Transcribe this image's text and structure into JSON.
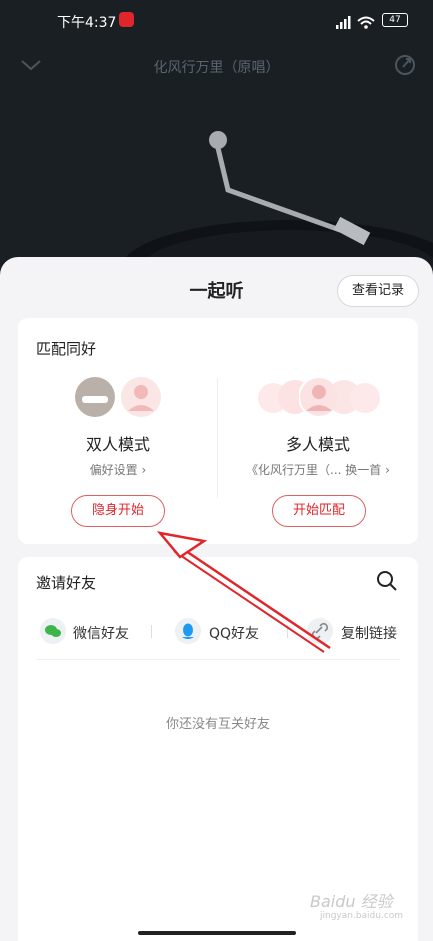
{
  "status": {
    "time": "下午4:37",
    "battery": "47"
  },
  "player": {
    "title": "化风行万里（原唱）"
  },
  "sheet": {
    "title": "一起听",
    "history_button": "查看记录",
    "match_section": "匹配同好",
    "modes": [
      {
        "title": "双人模式",
        "subtitle": "偏好设置",
        "button": "隐身开始"
      },
      {
        "title": "多人模式",
        "subtitle": "《化风行万里（... 换一首",
        "button": "开始匹配"
      }
    ],
    "invite_section": "邀请好友",
    "share": [
      {
        "label": "微信好友",
        "icon": "wechat-icon"
      },
      {
        "label": "QQ好友",
        "icon": "qq-icon"
      },
      {
        "label": "复制链接",
        "icon": "link-icon"
      }
    ],
    "empty_text": "你还没有互关好友"
  },
  "watermark": {
    "main": "Baidu 经验",
    "sub": "jingyan.baidu.com"
  },
  "colors": {
    "accent": "#e0262b",
    "sheet_bg": "#f4f4f7",
    "dark_bg": "#1a1f24",
    "annotation_arrow": "#e0262b"
  }
}
